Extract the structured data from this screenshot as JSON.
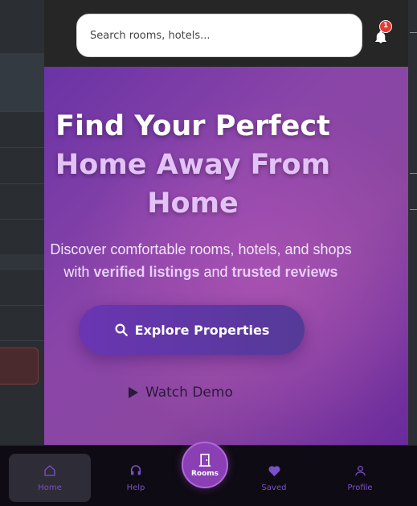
{
  "header": {
    "search_placeholder": "Search rooms, hotels...",
    "notification_count": "1"
  },
  "hero": {
    "title_line1": "Find Your Perfect",
    "title_line2": "Home Away From",
    "title_line3": "Home",
    "subtitle_part1": "Discover comfortable rooms, hotels, and shops",
    "subtitle_with": "with ",
    "subtitle_hl1": "verified listings",
    "subtitle_and": " and ",
    "subtitle_hl2": "trusted reviews",
    "explore_label": "Explore Properties",
    "demo_label": "Watch Demo"
  },
  "nav": {
    "home": "Home",
    "help": "Help",
    "rooms": "Rooms",
    "saved": "Saved",
    "profile": "Profile"
  },
  "icons": [
    "search-icon",
    "bell-icon",
    "play-icon",
    "home-icon",
    "headset-icon",
    "door-icon",
    "heart-icon",
    "user-icon"
  ],
  "colors": {
    "accent": "#7b4fc7",
    "badge": "#e53935",
    "hero_start": "#6b33a6",
    "hero_end": "#6a2a9c",
    "title_highlight": "#e3c2f7"
  }
}
